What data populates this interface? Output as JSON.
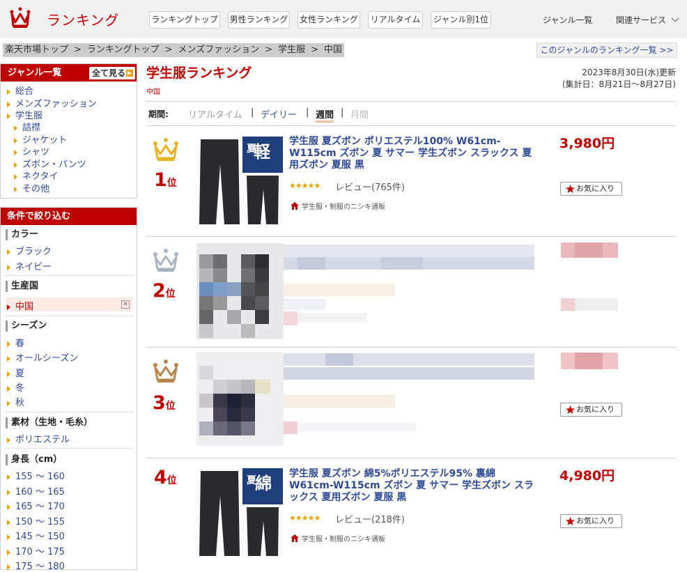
{
  "header": {
    "logo_text": "ランキング",
    "tabs": [
      "ランキングトップ",
      "男性ランキング",
      "女性ランキング",
      "リアルタイム",
      "ジャンル別1位"
    ],
    "genre_list": "ジャンル一覧",
    "related": "関連サービス"
  },
  "breadcrumb": [
    "楽天市場トップ",
    "ランキングトップ",
    "メンズファッション",
    "学生服",
    "中国"
  ],
  "genre_ranking_list_link": "このジャンルのランキング一覧 >>",
  "sidebar": {
    "genre_title": "ジャンル一覧",
    "view_all": "全て見る",
    "genres": [
      "総合",
      "メンズファッション",
      "学生服"
    ],
    "subgenres": [
      "詰襟",
      "ジャケット",
      "シャツ",
      "ズボン・パンツ",
      "ネクタイ",
      "その他"
    ],
    "filter_title": "条件で絞り込む",
    "color_title": "カラー",
    "colors": [
      "ブラック",
      "ネイビー"
    ],
    "origin_title": "生産国",
    "origin_selected": "中国",
    "season_title": "シーズン",
    "seasons": [
      "春",
      "オールシーズン",
      "夏",
      "冬",
      "秋"
    ],
    "material_title": "素材（生地・毛糸）",
    "materials": [
      "ポリエステル"
    ],
    "height_title": "身長（cm）",
    "heights": [
      "155 ～ 160",
      "160 ～ 165",
      "165 ～ 170",
      "150 ～ 155",
      "145 ～ 150",
      "170 ～ 175",
      "175 ～ 180"
    ]
  },
  "main": {
    "title": "学生服ランキング",
    "region": "中国",
    "update_date": "2023年8月30日(水)更新",
    "aggregation": "(集計日：8月21日～8月27日)",
    "period_label": "期間:",
    "periods": [
      "リアルタイム",
      "デイリー",
      "週間",
      "月間"
    ],
    "active_period": "週間",
    "separator": "|"
  },
  "items": [
    {
      "rank": "1",
      "rank_suffix": "位",
      "title": "学生服 夏ズボン ポリエステル100% W61cm-W115cm ズボン 夏 サマー 学生ズボン スラックス 夏用ズボン 夏服 黒",
      "price": "3,980円",
      "stars": "★★★★★",
      "review": "レビュー(765件)",
      "shop": "学生服・制服のニシキ通販",
      "favorite": "お気に入り",
      "thumb_label_big": "軽",
      "thumb_label_small": "夏",
      "crown_color": "#e6b422"
    },
    {
      "rank": "2",
      "rank_suffix": "位",
      "crown_color": "#a9b4c2"
    },
    {
      "rank": "3",
      "rank_suffix": "位",
      "favorite": "お気に入り",
      "crown_color": "#b8864b"
    },
    {
      "rank": "4",
      "rank_suffix": "位",
      "title": "学生服 夏ズボン 綿5%ポリエステル95% 裏綿 W61cm-W115cm ズボン 夏 サマー 学生ズボン スラックス 夏用ズボン 夏服 黒",
      "price": "4,980円",
      "stars": "★★★★★",
      "review": "レビュー(218件)",
      "shop": "学生服・制服のニシキ通販",
      "favorite": "お気に入り",
      "thumb_label_big": "綿",
      "thumb_label_small": "夏"
    }
  ],
  "colors": {
    "brand_red": "#bf0000",
    "link_blue": "#2f4a94",
    "star_gold": "#e6a400"
  }
}
